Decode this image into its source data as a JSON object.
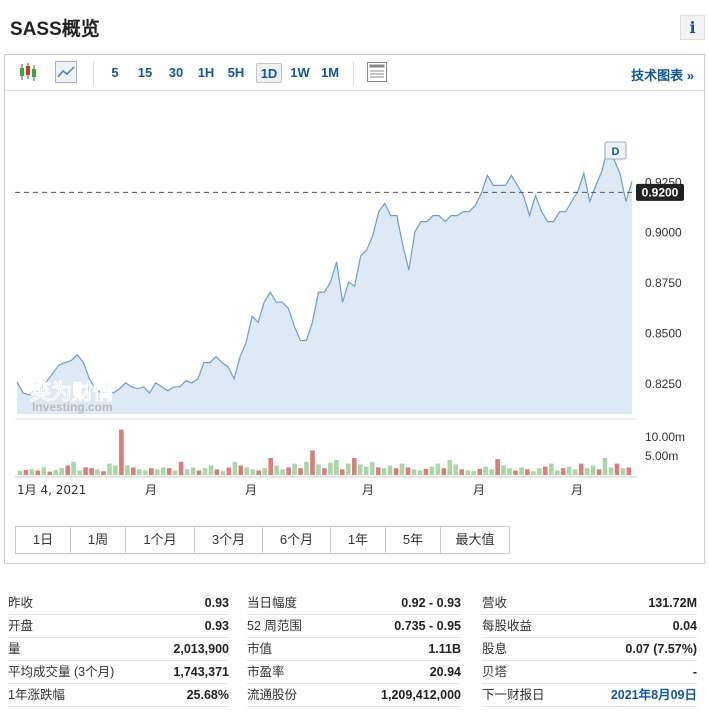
{
  "header": {
    "title": "SASS概览",
    "info_icon": "i"
  },
  "toolbar": {
    "intervals": [
      "5",
      "15",
      "30",
      "1H",
      "5H",
      "1D",
      "1W",
      "1M"
    ],
    "active_interval": "1D",
    "tech_chart_label": "技术图表 »"
  },
  "chart_data": {
    "type": "area",
    "price": {
      "ylim": [
        0.81,
        0.95
      ],
      "yticks": [
        "0.8250",
        "0.8500",
        "0.8750",
        "0.9000",
        "0.9250"
      ],
      "current_price_label": "0.9200",
      "current_price": 0.92,
      "marker_label": "D",
      "values": [
        0.826,
        0.8205,
        0.8195,
        0.822,
        0.8225,
        0.8265,
        0.8305,
        0.8345,
        0.8355,
        0.8365,
        0.8395,
        0.8355,
        0.8275,
        0.8225,
        0.8205,
        0.8215,
        0.8205,
        0.8225,
        0.8255,
        0.8235,
        0.8225,
        0.8235,
        0.8205,
        0.8255,
        0.8235,
        0.8215,
        0.8235,
        0.8235,
        0.8265,
        0.8255,
        0.8275,
        0.8355,
        0.8355,
        0.8385,
        0.8355,
        0.8335,
        0.8275,
        0.8385,
        0.8455,
        0.8585,
        0.8555,
        0.8655,
        0.8705,
        0.8655,
        0.8655,
        0.8625,
        0.8535,
        0.8465,
        0.8465,
        0.8555,
        0.8705,
        0.8705,
        0.8755,
        0.8855,
        0.8655,
        0.8755,
        0.8735,
        0.8885,
        0.8915,
        0.8985,
        0.9105,
        0.9145,
        0.9085,
        0.9085,
        0.8935,
        0.8815,
        0.9005,
        0.9055,
        0.9055,
        0.9085,
        0.9085,
        0.9055,
        0.9085,
        0.9085,
        0.9105,
        0.9105,
        0.9135,
        0.9195,
        0.9285,
        0.9235,
        0.9235,
        0.9235,
        0.9285,
        0.9235,
        0.9185,
        0.9085,
        0.9185,
        0.9105,
        0.9055,
        0.9055,
        0.9105,
        0.9105,
        0.9155,
        0.9205,
        0.9295,
        0.9155,
        0.9235,
        0.9305,
        0.9425,
        0.9365,
        0.9295,
        0.9155,
        0.9255
      ]
    },
    "volume": {
      "yticks": [
        "10.00m",
        "5.00m"
      ],
      "values_m": [
        1.1,
        1.3,
        1.5,
        1.2,
        2.0,
        0.9,
        1.3,
        1.8,
        2.5,
        3.5,
        1.2,
        2.0,
        1.8,
        1.5,
        1.0,
        3.0,
        2.5,
        12.0,
        2.5,
        2.0,
        1.5,
        1.2,
        1.8,
        1.5,
        2.0,
        1.8,
        1.2,
        3.5,
        1.5,
        2.0,
        1.2,
        1.8,
        2.5,
        1.5,
        1.0,
        2.0,
        3.5,
        2.5,
        2.0,
        1.5,
        1.2,
        1.8,
        4.5,
        2.5,
        1.5,
        2.0,
        3.0,
        1.8,
        3.5,
        6.5,
        2.8,
        1.8,
        3.2,
        4.0,
        1.5,
        3.0,
        4.5,
        2.8,
        2.2,
        3.5,
        2.0,
        1.8,
        2.5,
        1.8,
        3.0,
        2.0,
        1.5,
        1.2,
        1.6,
        2.2,
        3.0,
        1.8,
        4.0,
        2.8,
        1.5,
        1.2,
        1.0,
        1.6,
        2.2,
        1.5,
        4.2,
        2.5,
        1.8,
        1.2,
        2.0,
        1.5,
        1.0,
        1.8,
        2.2,
        3.0,
        1.2,
        1.8,
        2.2,
        1.5,
        3.0,
        1.8,
        2.5,
        1.5,
        4.5,
        2.0,
        3.0,
        1.8,
        2.0
      ],
      "colors": [
        "g",
        "r",
        "g",
        "r",
        "g",
        "r",
        "g",
        "g",
        "r",
        "g",
        "g",
        "r",
        "r",
        "g",
        "r",
        "g",
        "g",
        "r",
        "g",
        "r",
        "g",
        "g",
        "r",
        "g",
        "g",
        "r",
        "g",
        "r",
        "g",
        "g",
        "r",
        "g",
        "g",
        "r",
        "g",
        "r",
        "g",
        "r",
        "g",
        "g",
        "r",
        "g",
        "r",
        "g",
        "g",
        "r",
        "g",
        "r",
        "g",
        "r",
        "g",
        "r",
        "g",
        "g",
        "r",
        "g",
        "r",
        "g",
        "g",
        "g",
        "r",
        "g",
        "g",
        "r",
        "g",
        "r",
        "g",
        "g",
        "r",
        "g",
        "g",
        "r",
        "g",
        "g",
        "r",
        "g",
        "g",
        "r",
        "g",
        "g",
        "r",
        "g",
        "g",
        "r",
        "g",
        "r",
        "g",
        "g",
        "r",
        "g",
        "g",
        "r",
        "g",
        "g",
        "r",
        "g",
        "g",
        "r",
        "g",
        "g",
        "r",
        "g",
        "r"
      ]
    },
    "xticks": [
      "1月 4, 2021",
      "月",
      "月",
      "月",
      "月",
      "月"
    ],
    "watermark": {
      "cn": "英为财情",
      "en": "Investing.com"
    },
    "colors": {
      "line": "#6b9fcf",
      "area": "#dde9f4",
      "vol_green": "#a8d8a8",
      "vol_red": "#e07b7b",
      "price_label_bg": "#222222"
    }
  },
  "range_buttons": [
    "1日",
    "1周",
    "1个月",
    "3个月",
    "6个月",
    "1年",
    "5年",
    "最大值"
  ],
  "stats": {
    "col1": [
      {
        "label": "昨收",
        "value": "0.93"
      },
      {
        "label": "开盘",
        "value": "0.93"
      },
      {
        "label": "量",
        "value": "2,013,900"
      },
      {
        "label": "平均成交量 (3个月)",
        "value": "1,743,371"
      },
      {
        "label": "1年涨跌幅",
        "value": "25.68%"
      }
    ],
    "col2": [
      {
        "label": "当日幅度",
        "value": "0.92 - 0.93"
      },
      {
        "label": "52 周范围",
        "value": "0.735 - 0.95"
      },
      {
        "label": "市值",
        "value": "1.11B"
      },
      {
        "label": "市盈率",
        "value": "20.94"
      },
      {
        "label": "流通股份",
        "value": "1,209,412,000"
      }
    ],
    "col3": [
      {
        "label": "营收",
        "value": "131.72M"
      },
      {
        "label": "每股收益",
        "value": "0.04"
      },
      {
        "label": "股息",
        "value": "0.07 (7.57%)"
      },
      {
        "label": "贝塔",
        "value": "-"
      },
      {
        "label": "下一财报日",
        "value": "2021年8月09日",
        "link": true
      }
    ]
  }
}
